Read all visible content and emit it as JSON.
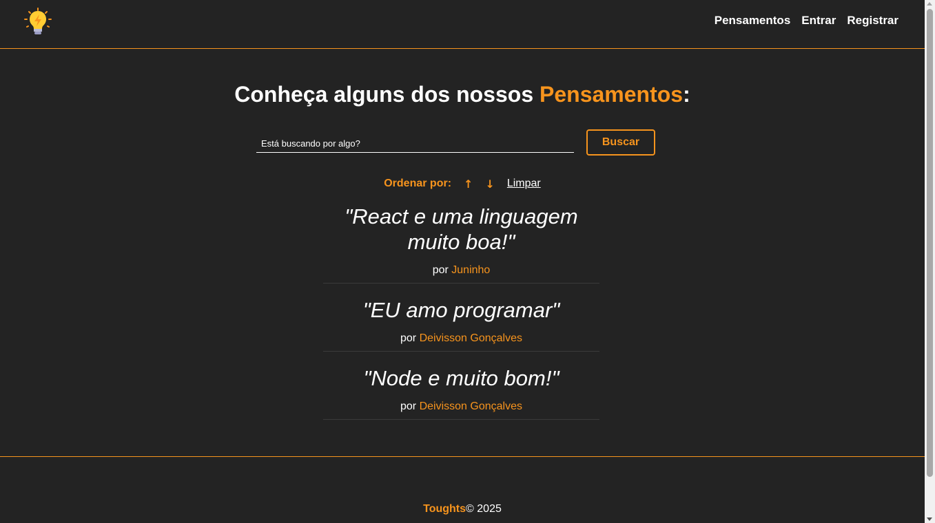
{
  "nav": {
    "logo_icon": "lightbulb-icon",
    "links": [
      "Pensamentos",
      "Entrar",
      "Registrar"
    ]
  },
  "main": {
    "heading_prefix": "Conheça alguns dos nossos ",
    "heading_accent": "Pensamentos",
    "heading_suffix": ":",
    "search": {
      "placeholder": "Está buscando por algo?",
      "button_label": "Buscar"
    },
    "order": {
      "label": "Ordenar por:",
      "asc_icon": "↑",
      "desc_icon": "↓",
      "clear_label": "Limpar"
    },
    "thoughts": [
      {
        "text": "\"React e uma linguagem muito boa!\"",
        "by": "por ",
        "author": "Juninho"
      },
      {
        "text": "\"EU amo programar\"",
        "by": "por ",
        "author": "Deivisson Gonçalves"
      },
      {
        "text": "\"Node e muito bom!\"",
        "by": "por ",
        "author": "Deivisson Gonçalves"
      }
    ]
  },
  "footer": {
    "brand": "Toughts",
    "copyright": "© 2025"
  },
  "colors": {
    "background": "#232323",
    "accent": "#f7941d",
    "text": "#ffffff"
  }
}
